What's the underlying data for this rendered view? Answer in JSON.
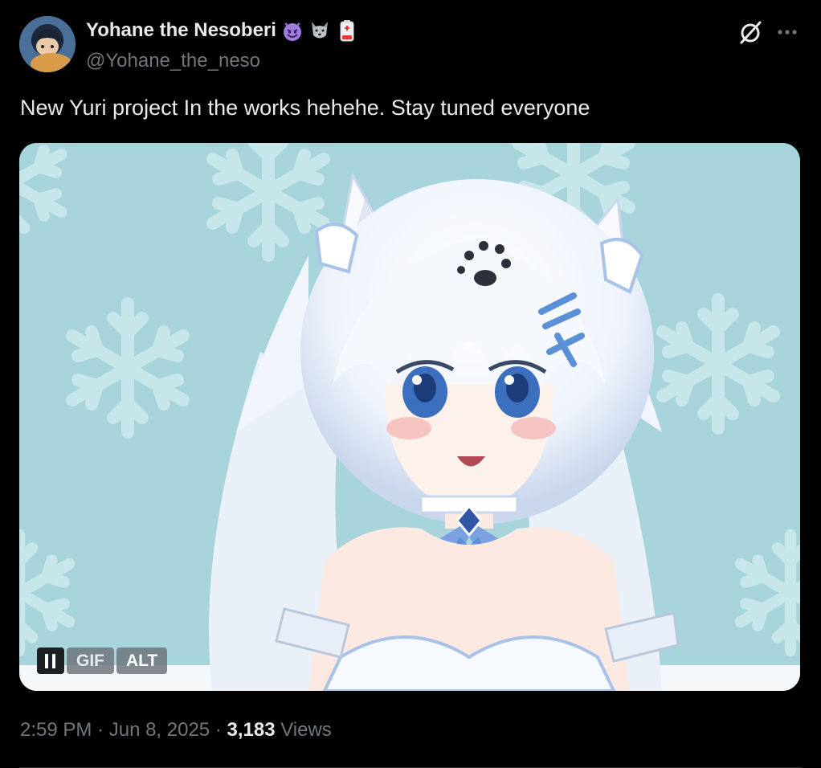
{
  "author": {
    "display_name": "Yohane the Nesoberi",
    "handle": "@Yohane_the_neso",
    "badges": [
      "smiling-devil-emoji",
      "wolf-emoji",
      "low-battery-emoji"
    ]
  },
  "tweet": {
    "text": "New Yuri project In the works hehehe. Stay tuned everyone"
  },
  "media": {
    "controls": {
      "pause_label": "II",
      "gif_label": "GIF",
      "alt_label": "ALT"
    }
  },
  "meta": {
    "time": "2:59 PM",
    "separator": " · ",
    "date": "Jun 8, 2025",
    "views_count": "3,183",
    "views_label": "Views"
  },
  "colors": {
    "background": "#000000",
    "text_primary": "#e7e9ea",
    "text_secondary": "#71767b",
    "media_bg": "#a7d4da"
  },
  "icons": {
    "grok": "grok-icon",
    "more": "more-icon"
  }
}
